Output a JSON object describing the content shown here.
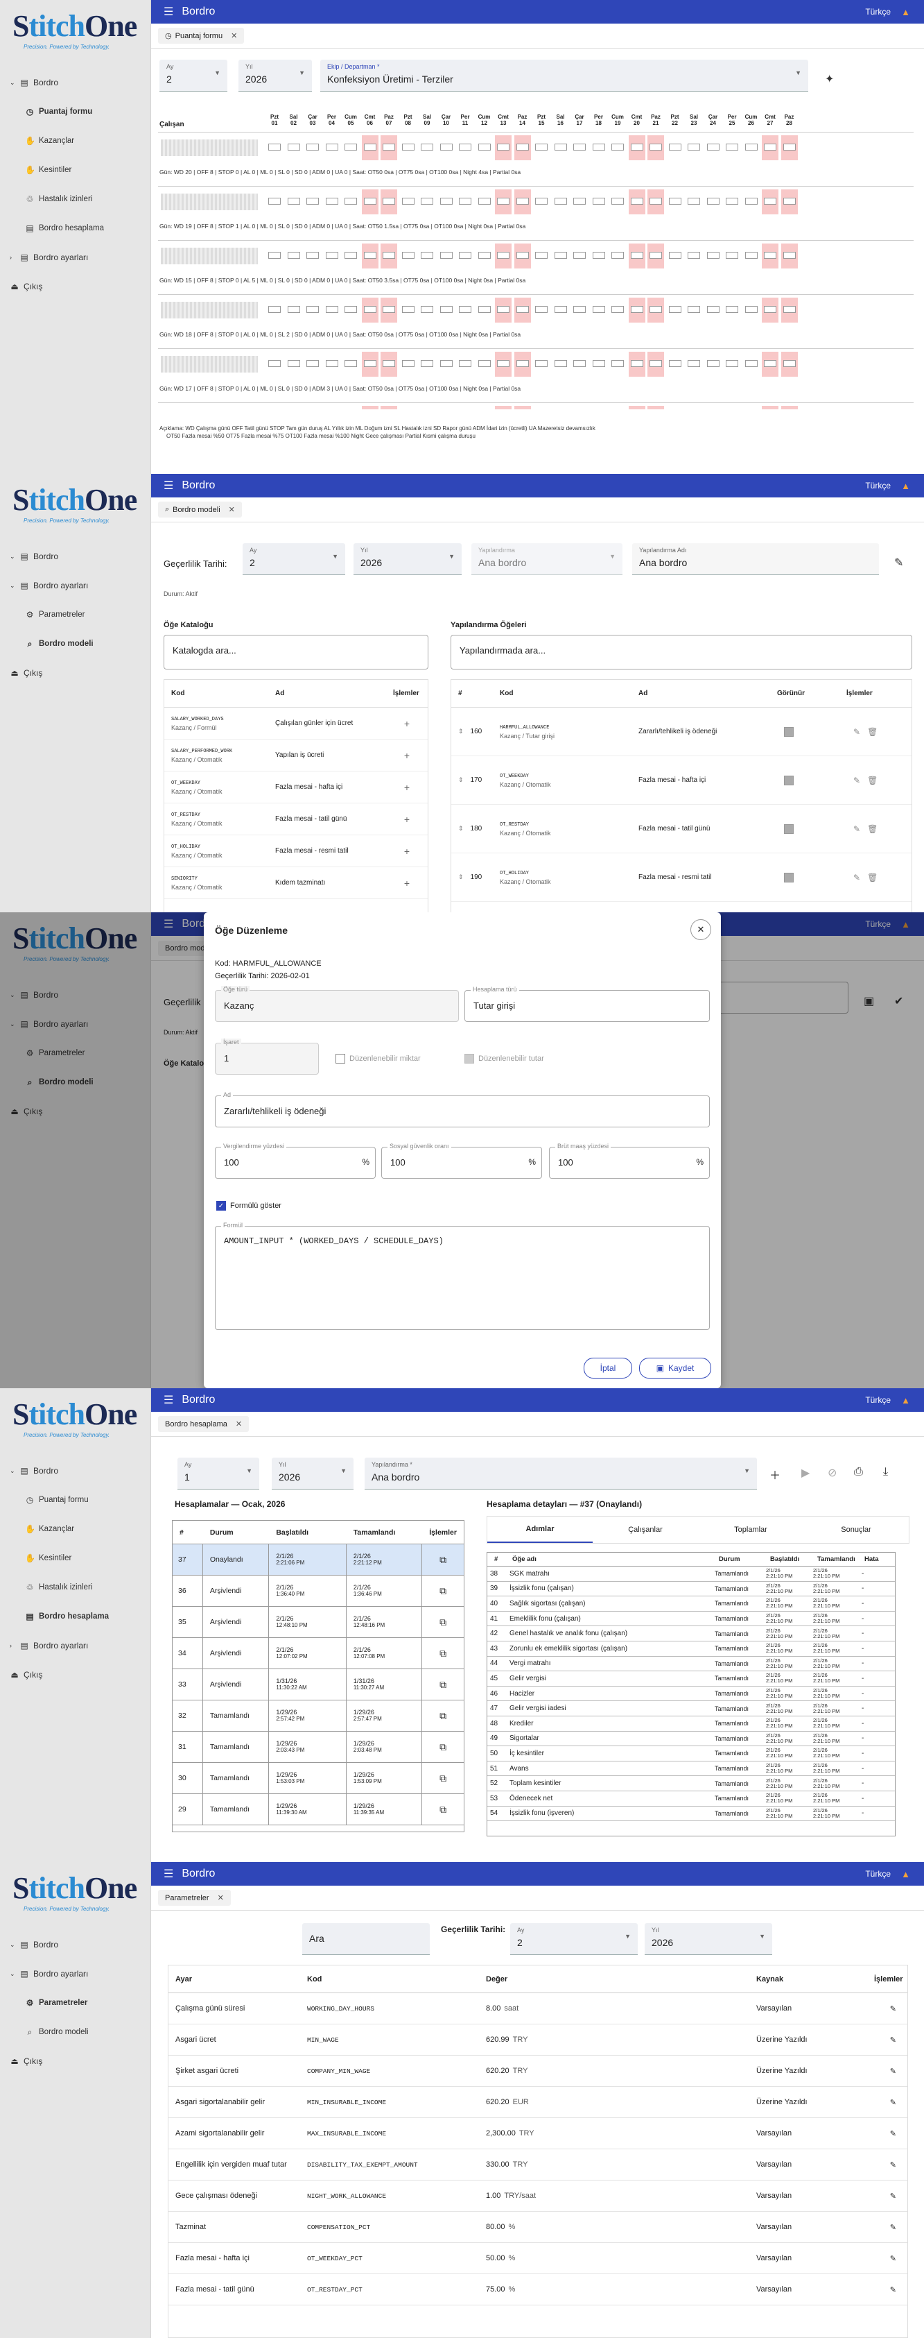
{
  "brand": {
    "logo_text": "StitchOne",
    "tagline": "Precision. Powered by Technology."
  },
  "topbar": {
    "title": "Bordro",
    "lang": "Türkçe"
  },
  "p1": {
    "nav": [
      {
        "label": "Bordro"
      },
      {
        "label": "Puantaj formu"
      },
      {
        "label": "Kazançlar"
      },
      {
        "label": "Kesintiler"
      },
      {
        "label": "Hastalık izinleri"
      },
      {
        "label": "Bordro hesaplama"
      },
      {
        "label": "Bordro ayarları"
      },
      {
        "label": "Çıkış"
      }
    ],
    "tab": "Puantaj formu",
    "month_label": "Ay",
    "month_value": "2",
    "year_label": "Yıl",
    "year_value": "2026",
    "unit_label": "Ekip / Departman *",
    "unit_value": "Konfeksiyon Üretimi - Terziler",
    "employee_header": "Çalışan",
    "day_names": [
      "Pzt",
      "Sal",
      "Çar",
      "Per",
      "Cum",
      "Cmt",
      "Paz",
      "Pzt",
      "Sal",
      "Çar",
      "Per",
      "Cum",
      "Cmt",
      "Paz",
      "Pzt",
      "Sal",
      "Çar",
      "Per",
      "Cum",
      "Cmt",
      "Paz",
      "Pzt",
      "Sal",
      "Çar",
      "Per",
      "Cum",
      "Cmt",
      "Paz"
    ],
    "day_nums": [
      "01",
      "02",
      "03",
      "04",
      "05",
      "06",
      "07",
      "08",
      "09",
      "10",
      "11",
      "12",
      "13",
      "14",
      "15",
      "16",
      "17",
      "18",
      "19",
      "20",
      "21",
      "22",
      "23",
      "24",
      "25",
      "26",
      "27",
      "28"
    ],
    "summaries": [
      "Gün: WD 20 | OFF 8 | STOP 0 | AL 0 | ML 0 | SL 0 | SD 0 | ADM 0 | UA 0 | Saat: OT50 0sa | OT75 0sa | OT100 0sa | Night 4sa | Partial 0sa",
      "Gün: WD 19 | OFF 8 | STOP 1 | AL 0 | ML 0 | SL 0 | SD 0 | ADM 0 | UA 0 | Saat: OT50 1.5sa | OT75 0sa | OT100 0sa | Night 0sa | Partial 0sa",
      "Gün: WD 15 | OFF 8 | STOP 0 | AL 5 | ML 0 | SL 0 | SD 0 | ADM 0 | UA 0 | Saat: OT50 3.5sa | OT75 0sa | OT100 0sa | Night 0sa | Partial 0sa",
      "Gün: WD 18 | OFF 8 | STOP 0 | AL 0 | ML 0 | SL 2 | SD 0 | ADM 0 | UA 0 | Saat: OT50 0sa | OT75 0sa | OT100 0sa | Night 0sa | Partial 0sa",
      "Gün: WD 17 | OFF 8 | STOP 0 | AL 0 | ML 0 | SL 0 | SD 0 | ADM 3 | UA 0 | Saat: OT50 0sa | OT75 0sa | OT100 0sa | Night 0sa | Partial 0sa"
    ],
    "legend_1": "Açıklama: WD Çalışma günü OFF Tatil günü STOP Tam gün duruş AL Yıllık izin ML Doğum izni SL Hastalık izni SD Rapor günü ADM İdari izin (ücretli) UA Mazeretsiz devamsızlık",
    "legend_2": "OT50 Fazla mesai %50 OT75 Fazla mesai %75 OT100 Fazla mesai %100 Night Gece çalışması Partial Kısmi çalışma duruşu"
  },
  "p2": {
    "nav": [
      {
        "label": "Bordro"
      },
      {
        "label": "Bordro ayarları"
      },
      {
        "label": "Parametreler"
      },
      {
        "label": "Bordro modeli"
      },
      {
        "label": "Çıkış"
      }
    ],
    "tab": "Bordro modeli",
    "validity_label": "Geçerlilik Tarihi:",
    "month_label": "Ay",
    "month_value": "2",
    "year_label": "Yıl",
    "year_value": "2026",
    "config_label": "Yapılandırma",
    "config_value": "Ana bordro",
    "config_name_label": "Yapılandırma Adı",
    "config_name_value": "Ana bordro",
    "status": "Durum: Aktif",
    "catalog_title": "Öğe Kataloğu",
    "catalog_search": "Katalogda ara...",
    "config_title": "Yapılandırma Öğeleri",
    "config_search": "Yapılandırmada ara...",
    "catalog_cols": [
      "Kod",
      "Ad",
      "İşlemler"
    ],
    "catalog_rows": [
      {
        "code": "SALARY_WORKED_DAYS",
        "type": "Kazanç / Formül",
        "name": "Çalışılan günler için ücret"
      },
      {
        "code": "SALARY_PERFORMED_WORK",
        "type": "Kazanç / Otomatik",
        "name": "Yapılan iş ücreti"
      },
      {
        "code": "OT_WEEKDAY",
        "type": "Kazanç / Otomatik",
        "name": "Fazla mesai - hafta içi"
      },
      {
        "code": "OT_RESTDAY",
        "type": "Kazanç / Otomatik",
        "name": "Fazla mesai - tatil günü"
      },
      {
        "code": "OT_HOLIDAY",
        "type": "Kazanç / Otomatik",
        "name": "Fazla mesai - resmi tatil"
      },
      {
        "code": "SENIORITY",
        "type": "Kazanç / Otomatik",
        "name": "Kıdem tazminatı"
      }
    ],
    "config_cols": [
      "#",
      "Kod",
      "Ad",
      "Görünür",
      "İşlemler"
    ],
    "config_rows": [
      {
        "num": "160",
        "code": "HARMFUL_ALLOWANCE",
        "type": "Kazanç / Tutar girişi",
        "name": "Zararlı/tehlikeli iş ödeneği"
      },
      {
        "num": "170",
        "code": "OT_WEEKDAY",
        "type": "Kazanç / Otomatik",
        "name": "Fazla mesai - hafta içi"
      },
      {
        "num": "180",
        "code": "OT_RESTDAY",
        "type": "Kazanç / Otomatik",
        "name": "Fazla mesai - tatil günü"
      },
      {
        "num": "190",
        "code": "OT_HOLIDAY",
        "type": "Kazanç / Otomatik",
        "name": "Fazla mesai - resmi tatil"
      }
    ]
  },
  "p3": {
    "dialog_title": "Öğe Düzenleme",
    "code_line": "Kod: HARMFUL_ALLOWANCE",
    "validity_line": "Geçerlilik Tarihi: 2026-02-01",
    "type_label": "Öğe türü",
    "type_value": "Kazanç",
    "calc_label": "Hesaplama türü",
    "calc_value": "Tutar girişi",
    "order_label": "İşaret",
    "order_value": "1",
    "editable_qty": "Düzenlenebilir miktar",
    "editable_amt": "Düzenlenebilir tutar",
    "name_label": "Ad",
    "name_value": "Zararlı/tehlikeli iş ödeneği",
    "tax_label": "Vergilendirme yüzdesi",
    "tax_value": "100",
    "ss_label": "Sosyal güvenlik oranı",
    "ss_value": "100",
    "gross_label": "Brüt maaş yüzdesi",
    "gross_value": "100",
    "pct": "%",
    "show_formula": "Formülü göster",
    "formula_label": "Formül",
    "formula_value": "AMOUNT_INPUT * (WORKED_DAYS / SCHEDULE_DAYS)",
    "cancel": "İptal",
    "save": "Kaydet",
    "bg_tab": "Bordro modeli",
    "bg_label": "Geçerlilik",
    "bg_status": "Durum: Aktif",
    "bg_catalog": "Öğe Kataloğu"
  },
  "p4": {
    "nav": [
      {
        "label": "Bordro"
      },
      {
        "label": "Puantaj formu"
      },
      {
        "label": "Kazançlar"
      },
      {
        "label": "Kesintiler"
      },
      {
        "label": "Hastalık izinleri"
      },
      {
        "label": "Bordro hesaplama"
      },
      {
        "label": "Bordro ayarları"
      },
      {
        "label": "Çıkış"
      }
    ],
    "tab": "Bordro hesaplama",
    "month_label": "Ay",
    "month_value": "1",
    "year_label": "Yıl",
    "year_value": "2026",
    "config_label": "Yapılandırma *",
    "config_value": "Ana bordro",
    "list_title": "Hesaplamalar — Ocak, 2026",
    "list_cols": [
      "#",
      "Durum",
      "Başlatıldı",
      "Tamamlandı",
      "İşlemler"
    ],
    "list_rows": [
      {
        "n": "37",
        "st": "Onaylandı",
        "s1": "2/1/26",
        "s2": "2:21:06 PM",
        "e1": "2/1/26",
        "e2": "2:21:12 PM"
      },
      {
        "n": "36",
        "st": "Arşivlendi",
        "s1": "2/1/26",
        "s2": "1:36:40 PM",
        "e1": "2/1/26",
        "e2": "1:36:46 PM"
      },
      {
        "n": "35",
        "st": "Arşivlendi",
        "s1": "2/1/26",
        "s2": "12:48:10 PM",
        "e1": "2/1/26",
        "e2": "12:48:16 PM"
      },
      {
        "n": "34",
        "st": "Arşivlendi",
        "s1": "2/1/26",
        "s2": "12:07:02 PM",
        "e1": "2/1/26",
        "e2": "12:07:08 PM"
      },
      {
        "n": "33",
        "st": "Arşivlendi",
        "s1": "1/31/26",
        "s2": "11:30:22 AM",
        "e1": "1/31/26",
        "e2": "11:30:27 AM"
      },
      {
        "n": "32",
        "st": "Tamamlandı",
        "s1": "1/29/26",
        "s2": "2:57:42 PM",
        "e1": "1/29/26",
        "e2": "2:57:47 PM"
      },
      {
        "n": "31",
        "st": "Tamamlandı",
        "s1": "1/29/26",
        "s2": "2:03:43 PM",
        "e1": "1/29/26",
        "e2": "2:03:48 PM"
      },
      {
        "n": "30",
        "st": "Tamamlandı",
        "s1": "1/29/26",
        "s2": "1:53:03 PM",
        "e1": "1/29/26",
        "e2": "1:53:09 PM"
      },
      {
        "n": "29",
        "st": "Tamamlandı",
        "s1": "1/29/26",
        "s2": "11:39:30 AM",
        "e1": "1/29/26",
        "e2": "11:39:35 AM"
      }
    ],
    "detail_title": "Hesaplama detayları — #37 (Onaylandı)",
    "detail_tabs": [
      "Adımlar",
      "Çalışanlar",
      "Toplamlar",
      "Sonuçlar"
    ],
    "detail_cols": [
      "#",
      "Öğe adı",
      "Durum",
      "Başlatıldı",
      "Tamamlandı",
      "Hata"
    ],
    "detail_rows": [
      {
        "n": "38",
        "name": "SGK matrahı"
      },
      {
        "n": "39",
        "name": "İşsizlik fonu (çalışan)"
      },
      {
        "n": "40",
        "name": "Sağlık sigortası (çalışan)"
      },
      {
        "n": "41",
        "name": "Emeklilik fonu (çalışan)"
      },
      {
        "n": "42",
        "name": "Genel hastalık ve analık fonu (çalışan)"
      },
      {
        "n": "43",
        "name": "Zorunlu ek emeklilik sigortası (çalışan)"
      },
      {
        "n": "44",
        "name": "Vergi matrahı"
      },
      {
        "n": "45",
        "name": "Gelir vergisi"
      },
      {
        "n": "46",
        "name": "Hacizler"
      },
      {
        "n": "47",
        "name": "Gelir vergisi iadesi"
      },
      {
        "n": "48",
        "name": "Krediler"
      },
      {
        "n": "49",
        "name": "Sigortalar"
      },
      {
        "n": "50",
        "name": "İç kesintiler"
      },
      {
        "n": "51",
        "name": "Avans"
      },
      {
        "n": "52",
        "name": "Toplam kesintiler"
      },
      {
        "n": "53",
        "name": "Ödenecek net"
      },
      {
        "n": "54",
        "name": "İşsizlik fonu (işveren)"
      }
    ],
    "detail_status": "Tamamlandı",
    "detail_d": "2/1/26",
    "detail_t1": "2:21:10 PM",
    "detail_t2": "2:21:10 PM",
    "detail_err": "-"
  },
  "p5": {
    "nav": [
      {
        "label": "Bordro"
      },
      {
        "label": "Bordro ayarları"
      },
      {
        "label": "Parametreler"
      },
      {
        "label": "Bordro modeli"
      },
      {
        "label": "Çıkış"
      }
    ],
    "tab": "Parametreler",
    "search": "Ara",
    "validity_label": "Geçerlilik Tarihi:",
    "month_label": "Ay",
    "month_value": "2",
    "year_label": "Yıl",
    "year_value": "2026",
    "cols": [
      "Ayar",
      "Kod",
      "Değer",
      "Kaynak",
      "İşlemler"
    ],
    "rows": [
      {
        "name": "Çalışma günü süresi",
        "code": "WORKING_DAY_HOURS",
        "val": "8.00",
        "unit": "saat",
        "src": "Varsayılan"
      },
      {
        "name": "Asgari ücret",
        "code": "MIN_WAGE",
        "val": "620.99",
        "unit": "TRY",
        "src": "Üzerine Yazıldı"
      },
      {
        "name": "Şirket asgari ücreti",
        "code": "COMPANY_MIN_WAGE",
        "val": "620.20",
        "unit": "TRY",
        "src": "Üzerine Yazıldı"
      },
      {
        "name": "Asgari sigortalanabilir gelir",
        "code": "MIN_INSURABLE_INCOME",
        "val": "620.20",
        "unit": "EUR",
        "src": "Üzerine Yazıldı"
      },
      {
        "name": "Azami sigortalanabilir gelir",
        "code": "MAX_INSURABLE_INCOME",
        "val": "2,300.00",
        "unit": "TRY",
        "src": "Varsayılan"
      },
      {
        "name": "Engellilik için vergiden muaf tutar",
        "code": "DISABILITY_TAX_EXEMPT_AMOUNT",
        "val": "330.00",
        "unit": "TRY",
        "src": "Varsayılan"
      },
      {
        "name": "Gece çalışması ödeneği",
        "code": "NIGHT_WORK_ALLOWANCE",
        "val": "1.00",
        "unit": "TRY/saat",
        "src": "Varsayılan"
      },
      {
        "name": "Tazminat",
        "code": "COMPENSATION_PCT",
        "val": "80.00",
        "unit": "%",
        "src": "Varsayılan"
      },
      {
        "name": "Fazla mesai - hafta içi",
        "code": "OT_WEEKDAY_PCT",
        "val": "50.00",
        "unit": "%",
        "src": "Varsayılan"
      },
      {
        "name": "Fazla mesai - tatil günü",
        "code": "OT_RESTDAY_PCT",
        "val": "75.00",
        "unit": "%",
        "src": "Varsayılan"
      }
    ]
  },
  "colors": {
    "topbar": "#2f46b8",
    "weekend": "#f8c8c8",
    "bell": "#f4a23a",
    "selected_row": "#d8e6f8"
  }
}
